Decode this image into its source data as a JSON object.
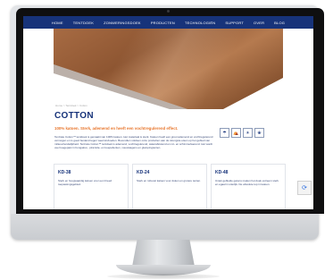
{
  "nav": {
    "items": [
      "HOME",
      "TENTDOEK",
      "ZONWERINGSDOEK",
      "PRODUCTEN",
      "TECHNOLOGIËN",
      "SUPPORT",
      "OVER",
      "BLOG"
    ]
  },
  "breadcrumb": "Home > Tentdoek > Cotton",
  "page": {
    "title": "COTTON",
    "subtitle": "100% katoen. Sterk, ademend en heeft een vochtregulerend effect.",
    "body": "TenCate Cotton™ tentdoek is gemaakt van 100% katoen. Het materiaal is sterk. Katoen heeft een groot ademend en vochtregulerend vermogen en is goed bestand tegen weersinvloeden. Bovendien voldoen onze producten aan de strengste eisen op het gebied van milieuvriendelijkheid. TenCate Cotton™ tentdoek is ademend, vochtregulerend, waterafstotend en rot- en schimmelwerend. Het wordt veel toegepast in bungalow-, piramide- en koepeltenten, vouwwagens en glampingtenten."
  },
  "icons": [
    {
      "name": "rain-icon",
      "glyph": "☂"
    },
    {
      "name": "tent-icon",
      "glyph": "⛺"
    },
    {
      "name": "sun-icon",
      "glyph": "☀"
    },
    {
      "name": "leaf-icon",
      "glyph": "❀"
    }
  ],
  "cards": [
    {
      "title": "KD-38",
      "text": "Sterk en hoogwaardig katoen voor een breed toepassingsgebied."
    },
    {
      "title": "KD-24",
      "text": "Sterk en robuust katoen voor doken en grotere tenten."
    },
    {
      "title": "KD-48",
      "text": "Uniek gebleide garens maken het doek extreem sterk en egaal in uiterlijk. De absolute top in katoen."
    }
  ],
  "colors": {
    "nav_bg": "#17337a",
    "title": "#17337a",
    "accent": "#e8772e"
  }
}
